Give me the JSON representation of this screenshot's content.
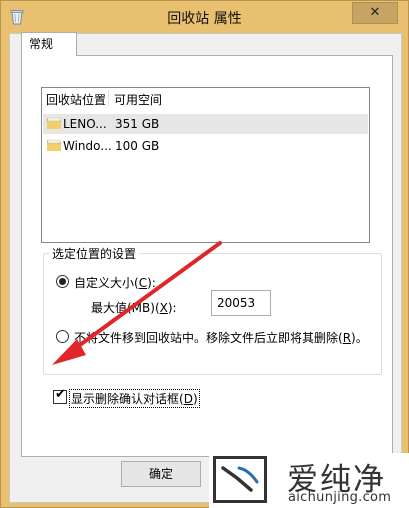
{
  "window": {
    "title": "回收站 属性",
    "close_glyph": "✕"
  },
  "tabs": [
    {
      "label": "常规",
      "selected": true
    }
  ],
  "location_list": {
    "headers": [
      "回收站位置",
      "可用空间"
    ],
    "rows": [
      {
        "name": "LENO...",
        "space": "351 GB",
        "selected": true
      },
      {
        "name": "Windo...",
        "space": "100 GB",
        "selected": false
      }
    ]
  },
  "settings": {
    "group_title": "选定位置的设置",
    "custom_size_label": "自定义大小(",
    "custom_size_key": "C",
    "custom_size_label_end": "):",
    "custom_size_selected": true,
    "max_label": "最大值(MB)(",
    "max_key": "X",
    "max_label_end": "):",
    "max_value": "20053",
    "no_move_label": "不将文件移到回收站中。移除文件后立即将其删除(",
    "no_move_key": "R",
    "no_move_label_end": ")。",
    "no_move_selected": false
  },
  "confirm": {
    "label": "显示删除确认对话框(",
    "key": "D",
    "label_end": ")",
    "checked": true
  },
  "buttons": {
    "ok": "确定"
  },
  "watermark": {
    "name": "爱纯净",
    "url": "aichunjing.com"
  },
  "colors": {
    "window_frame": "#e9c06f",
    "annotation_arrow": "#e0262a"
  }
}
